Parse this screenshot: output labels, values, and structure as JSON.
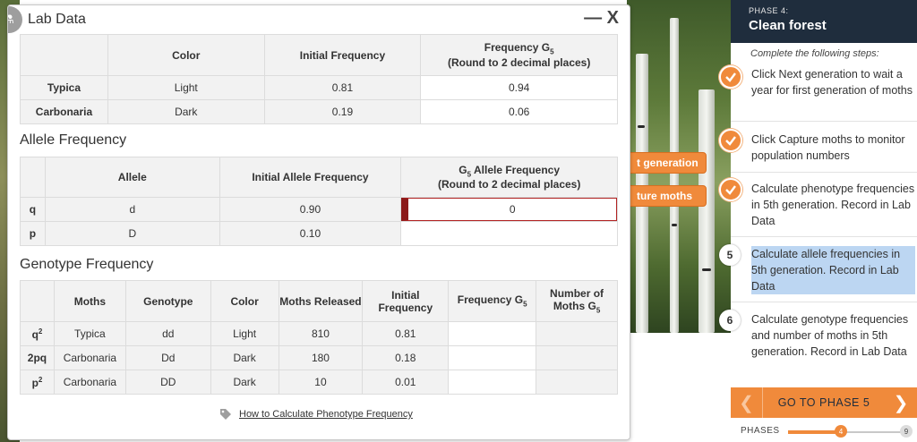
{
  "lab": {
    "title": "Lab Data",
    "close": "— X",
    "phenotype_table": {
      "headers": [
        "Color",
        "Initial Frequency",
        "Frequency G5 (Round to 2 decimal places)"
      ],
      "rows": [
        {
          "label": "Typica",
          "color": "Light",
          "initial": "0.81",
          "g5": "0.94"
        },
        {
          "label": "Carbonaria",
          "color": "Dark",
          "initial": "0.19",
          "g5": "0.06"
        }
      ]
    },
    "allele_section": "Allele Frequency",
    "allele_table": {
      "headers": [
        "Allele",
        "Initial Allele Frequency",
        "G5 Allele Frequency (Round to 2 decimal places)"
      ],
      "rows": [
        {
          "label": "q",
          "allele": "d",
          "initial": "0.90",
          "g5": "0"
        },
        {
          "label": "p",
          "allele": "D",
          "initial": "0.10",
          "g5": ""
        }
      ]
    },
    "genotype_section": "Genotype Frequency",
    "genotype_table": {
      "headers": [
        "Moths",
        "Genotype",
        "Color",
        "Moths Released",
        "Initial Frequency",
        "Frequency G5",
        "Number of Moths G5"
      ],
      "rows": [
        {
          "label": "q2",
          "moths": "Typica",
          "genotype": "dd",
          "color": "Light",
          "released": "810",
          "initial": "0.81",
          "freq_g5": "",
          "num_g5": ""
        },
        {
          "label": "2pq",
          "moths": "Carbonaria",
          "genotype": "Dd",
          "color": "Dark",
          "released": "180",
          "initial": "0.18",
          "freq_g5": "",
          "num_g5": ""
        },
        {
          "label": "p2",
          "moths": "Carbonaria",
          "genotype": "DD",
          "color": "Dark",
          "released": "10",
          "initial": "0.01",
          "freq_g5": "",
          "num_g5": ""
        }
      ]
    },
    "help_link": "How to Calculate Phenotype Frequency"
  },
  "scene_buttons": {
    "next_generation": "t generation",
    "capture_moths": "ture moths"
  },
  "panel": {
    "phase_label": "PHASE 4:",
    "phase_name": "Clean forest",
    "intro": "Complete the following steps:",
    "steps": [
      {
        "status": "done",
        "text": "Click Next generation to wait a year for first generation of moths"
      },
      {
        "status": "done",
        "text": "Click Capture moths to monitor population numbers"
      },
      {
        "status": "done",
        "text": "Calculate phenotype frequencies in 5th generation. Record in Lab Data"
      },
      {
        "status": "current",
        "number": "5",
        "text": "Calculate allele frequencies in 5th generation. Record in Lab Data"
      },
      {
        "status": "todo",
        "number": "6",
        "text": "Calculate genotype frequencies and number of moths in 5th generation. Record in Lab Data"
      }
    ],
    "goto_label": "GO TO PHASE 5",
    "phases_label": "PHASES",
    "phase_current": "4",
    "phase_total": "9",
    "phase_progress": 0.44
  },
  "colors": {
    "accent": "#f08a3b",
    "header_dark": "#1f2d3d",
    "highlight": "#bcd6f2",
    "error": "#8b1a1a"
  }
}
